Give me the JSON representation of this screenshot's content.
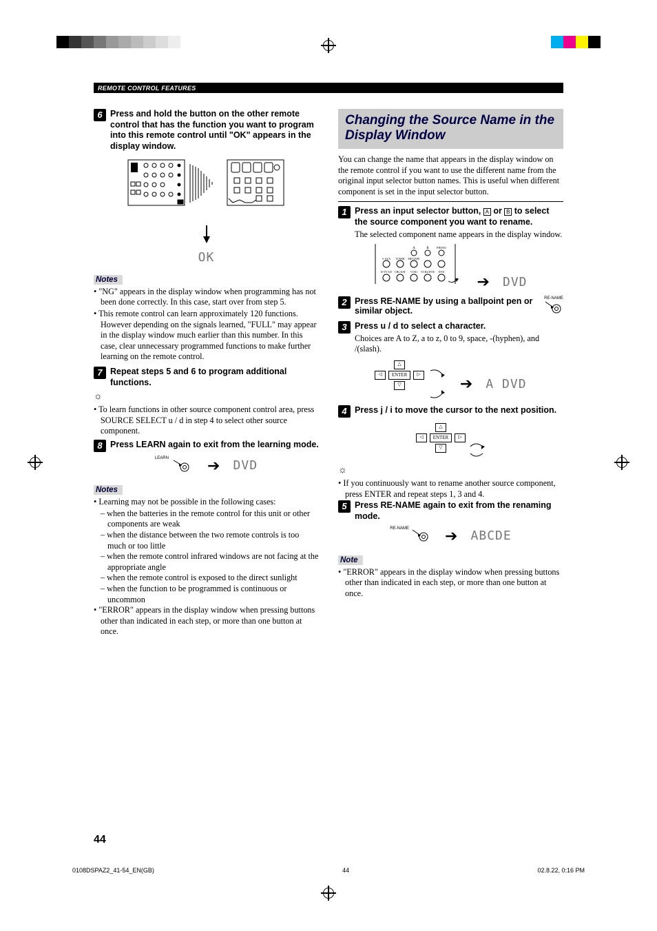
{
  "header": {
    "section_title": "REMOTE CONTROL FEATURES"
  },
  "left": {
    "step6": {
      "num": "6",
      "text": "Press and hold the button on the other remote control that has the function you want to program into this remote control until \"OK\" appears in the display window.",
      "display": "OK"
    },
    "notes1": {
      "heading": "Notes",
      "items": [
        "\"NG\" appears in the display window when programming has not been done correctly. In this case, start over from step 5.",
        "This remote control can learn approximately 120 functions. However depending on the signals learned, \"FULL\" may appear in the display window much earlier than this number. In this case, clear unnecessary programmed functions to make further learning on the remote control."
      ]
    },
    "step7": {
      "num": "7",
      "text": "Repeat steps 5 and 6 to program additional functions."
    },
    "tip": "To learn functions in other source component control area, press SOURCE SELECT u / d in step 4 to select other source component.",
    "step8": {
      "num": "8",
      "text": "Press LEARN again to exit from the learning mode.",
      "button_label": "LEARN",
      "display": "DVD"
    },
    "notes2": {
      "heading": "Notes",
      "lead": "Learning may not be possible in the following cases:",
      "subs": [
        "when the batteries in the remote control for this unit or other components are weak",
        "when the distance between the two remote controls is too much or too little",
        "when the remote control infrared windows are not facing at the appropriate angle",
        "when the remote control is exposed to the direct sunlight",
        "when the function to be programmed is continuous or uncommon"
      ],
      "tail": "\"ERROR\" appears in the display window when pressing buttons other than indicated in each step, or more than one button at once."
    }
  },
  "right": {
    "title": "Changing the Source Name in the Display Window",
    "intro": "You can change the name that appears in the display window on the remote control if you want to use the different name from the original input selector button names. This is useful when different component is set in the input selector button.",
    "step1": {
      "num": "1",
      "bold": "Press an input selector button, ",
      "a_label": "A",
      "or": " or ",
      "b_label": "B",
      "bold2": " to select the source component you want to rename.",
      "follow": "The selected component name appears in the display window.",
      "display": "DVD",
      "selector_labels": [
        "V-AUX",
        "TUNER",
        "MD/TAPE",
        "PHONO",
        "D-TV/LD",
        "CBL/SAT",
        "VCR1",
        "VCR2/DVR",
        "DVD"
      ],
      "ab_top": [
        "A",
        "B"
      ]
    },
    "step2": {
      "num": "2",
      "text": "Press RE-NAME by using a ballpoint pen or similar object.",
      "button_label": "RE-NAME"
    },
    "step3": {
      "num": "3",
      "bold": "Press u / d to select a character.",
      "follow": "Choices are A to Z, a to z, 0 to 9, space, -(hyphen), and /(slash).",
      "enter": "ENTER",
      "display": "A DVD"
    },
    "step4": {
      "num": "4",
      "bold": "Press j / i to move the cursor to the next position.",
      "enter": "ENTER"
    },
    "tip": "If you continuously want to rename another source component, press ENTER and repeat steps 1, 3 and 4.",
    "step5": {
      "num": "5",
      "text": "Press RE-NAME again to exit from the renaming mode.",
      "button_label": "RE-NAME",
      "display": "ABCDE"
    },
    "note": {
      "heading": "Note",
      "text": "\"ERROR\" appears in the display window when pressing buttons other than indicated in each step, or more than one button at once."
    }
  },
  "footer": {
    "file": "0108DSPAZ2_41-54_EN(GB)",
    "page_inner": "44",
    "date": "02.8.22, 0:16 PM"
  },
  "page_number": "44",
  "reg_colors_left": [
    "#000",
    "#333",
    "#555",
    "#777",
    "#999",
    "#aaa",
    "#bbb",
    "#ccc",
    "#ddd",
    "#eee"
  ],
  "reg_colors_right": [
    "#00aeef",
    "#ec008c",
    "#fff200",
    "#000"
  ]
}
